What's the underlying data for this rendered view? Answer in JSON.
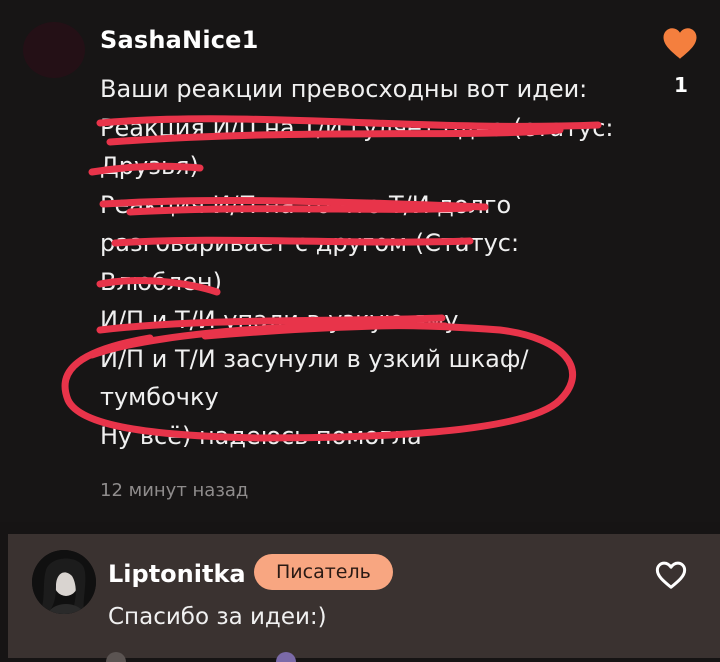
{
  "comment": {
    "author": "SashaNice1",
    "likes": "1",
    "lines": [
      "Ваши реакции превосходны вот идеи:",
      "Реакция И/П на Т/И гуляет одна (статус:",
      "Друзья)",
      "Реакция И/П на то что Т/И долго",
      "разговаривает с другом (Статус:",
      "Влюблен)",
      "И/П и Т/И упали в узкую яму",
      "И/П и Т/И засунули в узкий шкаф/",
      "тумбочку",
      "Ну всё) надеюсь помогла"
    ],
    "timestamp": "12 минут назад",
    "heart_color": "#f47f3e",
    "scribble_color": "#e8344a"
  },
  "reply": {
    "author": "Liptonitka",
    "badge": "Писатель",
    "text": "Спасибо за идеи:)",
    "badge_color": "#f8a681"
  },
  "icons": {
    "like_filled": "heart-icon",
    "like_outline": "heart-outline-icon"
  }
}
